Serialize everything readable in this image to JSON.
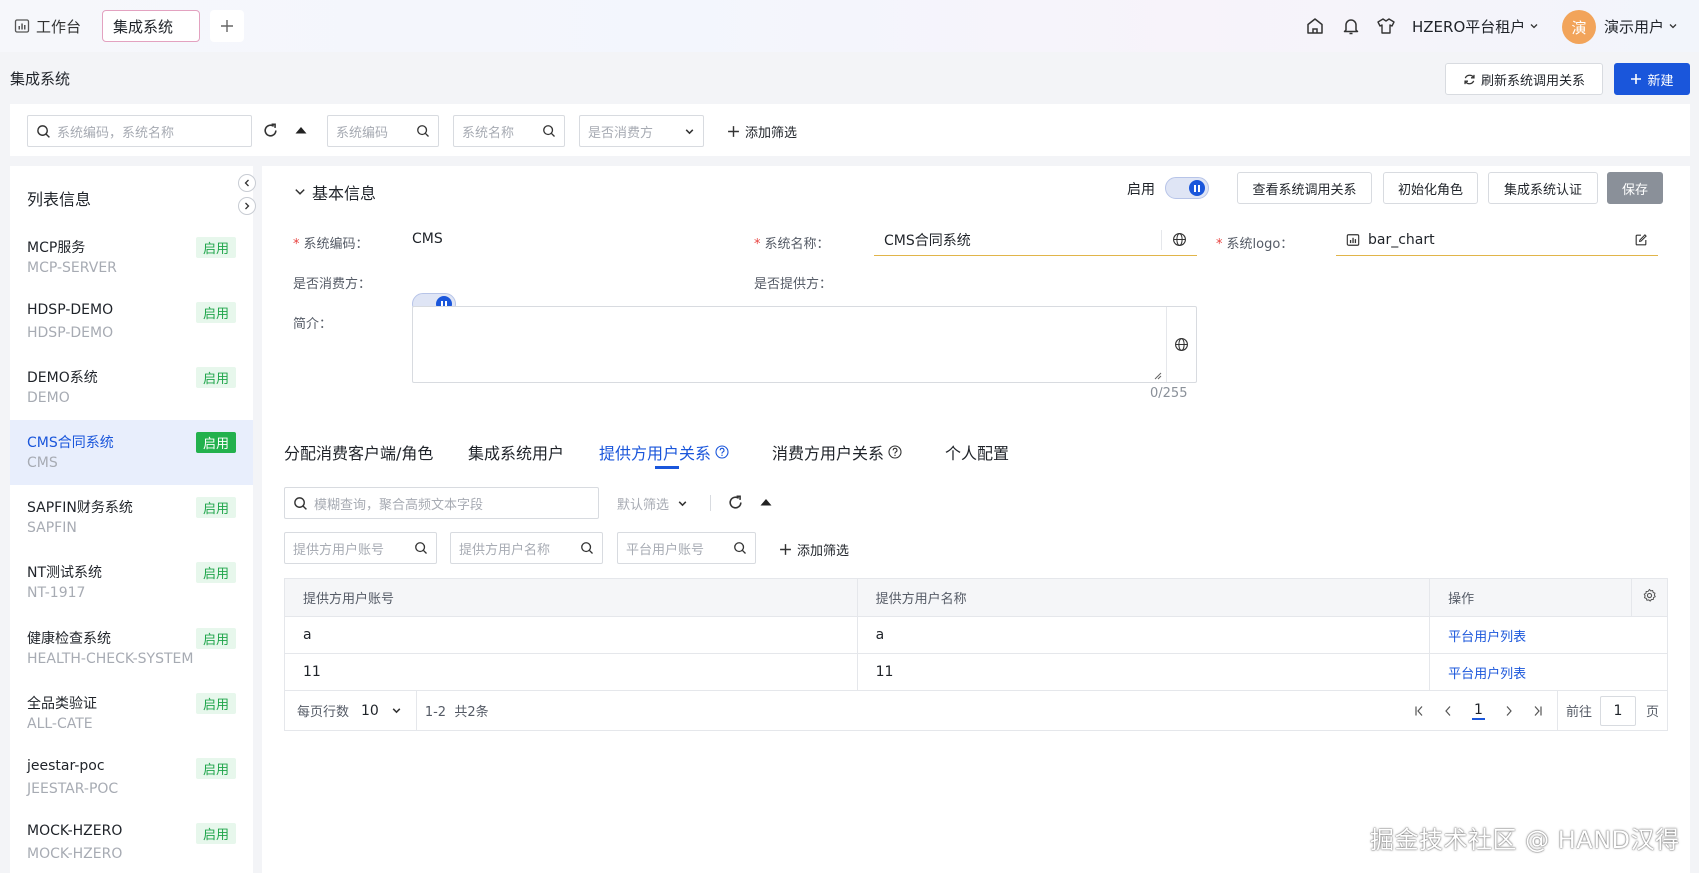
{
  "topbar": {
    "home_tab": "工作台",
    "active_tab": "集成系统",
    "tenant": "HZERO平台租户",
    "avatar_text": "演",
    "user": "演示用户"
  },
  "page": {
    "title": "集成系统",
    "refresh_btn": "刷新系统调用关系",
    "new_btn": "新建"
  },
  "filters": {
    "search_placeholder": "系统编码，系统名称",
    "code_placeholder": "系统编码",
    "name_placeholder": "系统名称",
    "consumer_placeholder": "是否消费方",
    "add_filter": "添加筛选"
  },
  "sidebar": {
    "title": "列表信息",
    "items": [
      {
        "name": "MCP服务",
        "code": "MCP-SERVER",
        "status": "启用"
      },
      {
        "name": "HDSP-DEMO",
        "code": "HDSP-DEMO",
        "status": "启用"
      },
      {
        "name": "DEMO系统",
        "code": "DEMO",
        "status": "启用"
      },
      {
        "name": "CMS合同系统",
        "code": "CMS",
        "status": "启用"
      },
      {
        "name": "SAPFIN财务系统",
        "code": "SAPFIN",
        "status": "启用"
      },
      {
        "name": "NT测试系统",
        "code": "NT-1917",
        "status": "启用"
      },
      {
        "name": "健康检查系统",
        "code": "HEALTH-CHECK-SYSTEM",
        "status": "启用"
      },
      {
        "name": "全品类验证",
        "code": "ALL-CATE",
        "status": "启用"
      },
      {
        "name": "jeestar-poc",
        "code": "JEESTAR-POC",
        "status": "启用"
      },
      {
        "name": "MOCK-HZERO",
        "code": "MOCK-HZERO",
        "status": "启用"
      }
    ]
  },
  "basic": {
    "section_title": "基本信息",
    "enable_label": "启用",
    "view_relation_btn": "查看系统调用关系",
    "init_role_btn": "初始化角色",
    "auth_btn": "集成系统认证",
    "save_btn": "保存",
    "code_label": "系统编码：",
    "code_value": "CMS",
    "name_label": "系统名称：",
    "name_value": "CMS合同系统",
    "logo_label": "系统logo：",
    "logo_value": "bar_chart",
    "consumer_label": "是否消费方：",
    "provider_label": "是否提供方：",
    "intro_label": "简介：",
    "intro_value": "",
    "char_count": "0/255"
  },
  "tabs": [
    {
      "label": "分配消费客户端/角色"
    },
    {
      "label": "集成系统用户"
    },
    {
      "label": "提供方用户关系"
    },
    {
      "label": "消费方用户关系"
    },
    {
      "label": "个人配置"
    }
  ],
  "subfilter": {
    "search_placeholder": "模糊查询，聚合高频文本字段",
    "default_filter": "默认筛选",
    "provider_account_ph": "提供方用户账号",
    "provider_name_ph": "提供方用户名称",
    "platform_account_ph": "平台用户账号",
    "add_filter": "添加筛选"
  },
  "table": {
    "columns": [
      "提供方用户账号",
      "提供方用户名称",
      "操作"
    ],
    "rows": [
      {
        "account": "a",
        "name": "a",
        "action": "平台用户列表"
      },
      {
        "account": "11",
        "name": "11",
        "action": "平台用户列表"
      }
    ]
  },
  "pager": {
    "rows_label": "每页行数",
    "rows_value": "10",
    "range": "1-2  共2条",
    "current": "1",
    "goto_label": "前往",
    "goto_value": "1",
    "page_suffix": "页"
  },
  "watermark": "掘金技术社区 @ HAND汉得",
  "colors": {
    "primary": "#1a56db",
    "success": "#23b14d",
    "required": "#e8413e"
  }
}
